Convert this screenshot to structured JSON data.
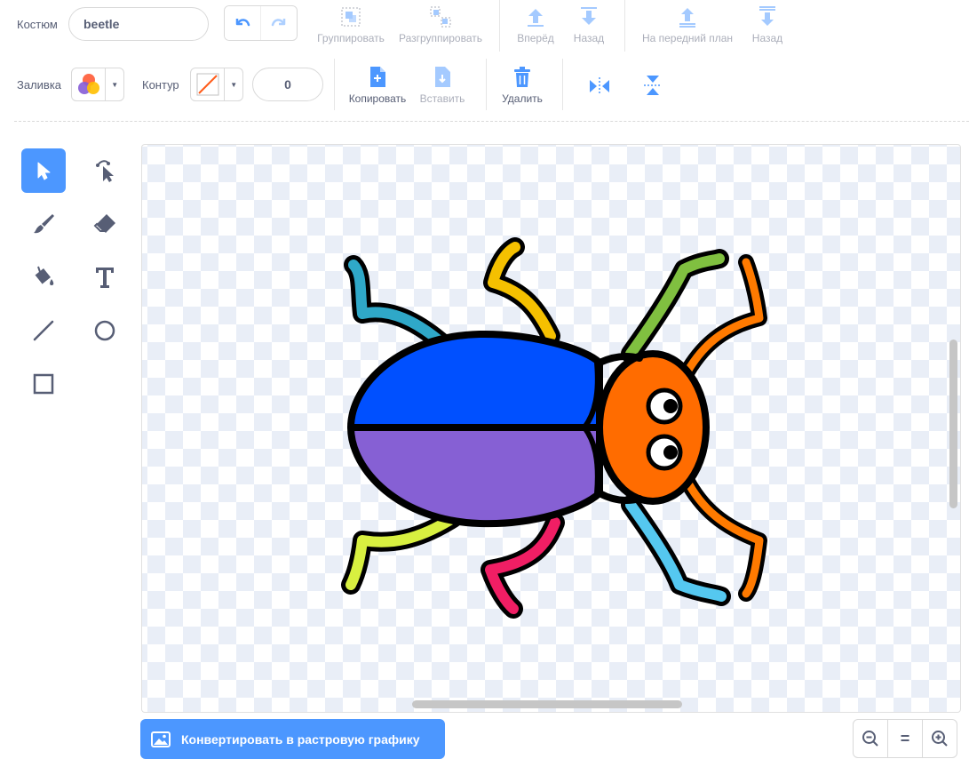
{
  "costume": {
    "label": "Костюм",
    "name_value": "beetle"
  },
  "toolbar": {
    "group_label": "Группировать",
    "ungroup_label": "Разгруппировать",
    "forward_label": "Вперёд",
    "backward_label": "Назад",
    "front_label": "На передний план",
    "back_label": "Назад",
    "copy_label": "Копировать",
    "paste_label": "Вставить",
    "delete_label": "Удалить"
  },
  "fill": {
    "label": "Заливка"
  },
  "outline": {
    "label": "Контур",
    "width_value": "0"
  },
  "tools": [
    "select",
    "reshape",
    "brush",
    "eraser",
    "fill",
    "text",
    "line",
    "circle",
    "rectangle"
  ],
  "convert_label": "Конвертировать в растровую графику",
  "zoom": {
    "reset_label": "="
  },
  "colors": {
    "accent": "#4c97ff",
    "text": "#575e75"
  }
}
